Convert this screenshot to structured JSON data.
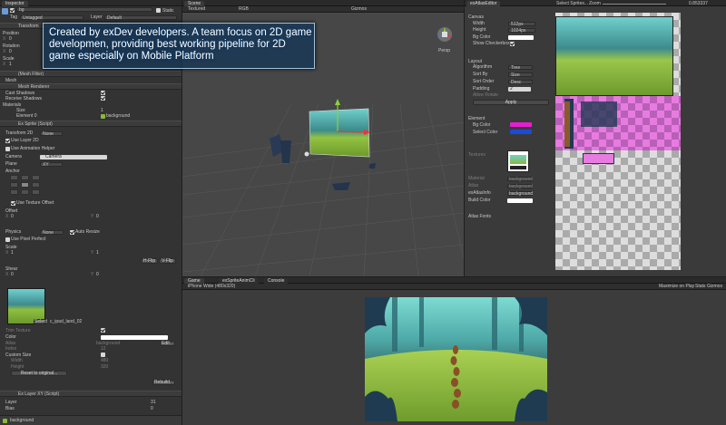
{
  "overlay_text": "Created by exDev developers. A team focus on 2D game developmen, providing best working pipeline for 2D game especially on Mobile Platform",
  "inspector": {
    "tab": "Inspector",
    "object_name": "bg",
    "static_label": "Static",
    "tag_label": "Tag",
    "tag_value": "Untagged",
    "layer_label": "Layer",
    "layer_value": "Default",
    "transform_title": "Transform",
    "position_label": "Position",
    "rotation_label": "Rotation",
    "scale_label": "Scale",
    "x_label": "X",
    "y_label": "Y",
    "z_label": "Z",
    "v0": "0",
    "v1": "1",
    "mesh_filter_title": "(Mesh Filter)",
    "mesh_label": "Mesh",
    "mesh_renderer_title": "Mesh Renderer",
    "cast_shadows": "Cast Shadows",
    "receive_shadows": "Receive Shadows",
    "materials_label": "Materials",
    "size_label": "Size",
    "size_value": "1",
    "element0_label": "Element 0",
    "element0_value": "background",
    "sprite_title": "Ex Sprite (Script)",
    "transform2d_label": "Transform 2D",
    "transform2d_value": "None",
    "use_layer2d": "Use Layer 2D",
    "use_anim_helper": "Use Animation Helper",
    "camera_label": "Camera",
    "camera_value": "Camera",
    "plane_label": "Plane",
    "plane_value": "XY",
    "anchor_label": "Anchor",
    "use_texture_offset": "Use Texture Offset",
    "offset_label": "Offset",
    "physics_label": "Physics",
    "physics_value": "None",
    "auto_resize": "Auto Resize",
    "use_pixel_perfect": "Use Pixel Perfect",
    "hflip": "H-Flip",
    "vflip": "V-Flip",
    "shear_label": "Shear",
    "atlas_label_name": "c_ipad_land_02",
    "select_label": "Select",
    "trim_texture": "Trim Texture",
    "color_label": "Color",
    "atlas_field": "Atlas",
    "atlas_value": "background",
    "index_field": "Index",
    "index_value": "12",
    "custom_size": "Custom Size",
    "width_field": "Width",
    "width_value": "480",
    "height_field": "Height",
    "height_value": "320",
    "reset_btn": "Reset to original...",
    "edit_btn": "Edit...",
    "rebuild_btn": "Rebuild...",
    "layerxy_title": "Ex Layer XY (Script)",
    "layer2_label": "Layer",
    "layer2_value": "31",
    "bias_label": "Bias",
    "bias_value": "0",
    "bottom_material": "background"
  },
  "scene": {
    "tab": "Scene",
    "mode": "Textured",
    "color_mode": "RGB",
    "gizmos": "Gizmos",
    "persp": "Persp"
  },
  "game": {
    "tab_game": "Game",
    "tab_anim": "exSpriteAnimCli",
    "tab_console": "Console",
    "resolution": "iPhone Wide (480x320)",
    "maximize": "Maximize on Play",
    "stats": "Stats",
    "gizmos": "Gizmos"
  },
  "atlas_editor": {
    "tab": "exAtlasEditor",
    "select_sprites": "Select Sprites...",
    "zoom_label": "Zoom",
    "zoom_value": "0.853337",
    "canvas_title": "Canvas",
    "width_label": "Width",
    "width_value": "512px",
    "height_label": "Height",
    "height_value": "1024px",
    "bg_color_label": "Bg Color",
    "show_checkerbox": "Show Checkerbox",
    "layout_title": "Layout",
    "algorithm_label": "Algorithm",
    "algorithm_value": "Tree",
    "sortby_label": "Sort By",
    "sortby_value": "Size",
    "sortorder_label": "Sort Order",
    "sortorder_value": "Desc",
    "padding_label": "Padding",
    "padding_value": "2",
    "allow_rotate": "Allow Rotate",
    "apply_btn": "Apply",
    "element_title": "Element",
    "el_bg_color": "Bg Color",
    "select_color": "Select Color",
    "textures_label": "Textures",
    "material_label": "Material",
    "material_value": "background",
    "atlas_label": "Atlas",
    "atlas_value": "background",
    "atlasinfo_label": "exAtlasInfo",
    "atlasinfo_value": "background",
    "build_color": "Build Color",
    "atlas_fonts": "Atlas Fonts"
  },
  "colors": {
    "accent": "#3d6fb6",
    "sky": "#7fd6d2",
    "grass": "#8ab83a",
    "magenta": "#e87be0"
  }
}
